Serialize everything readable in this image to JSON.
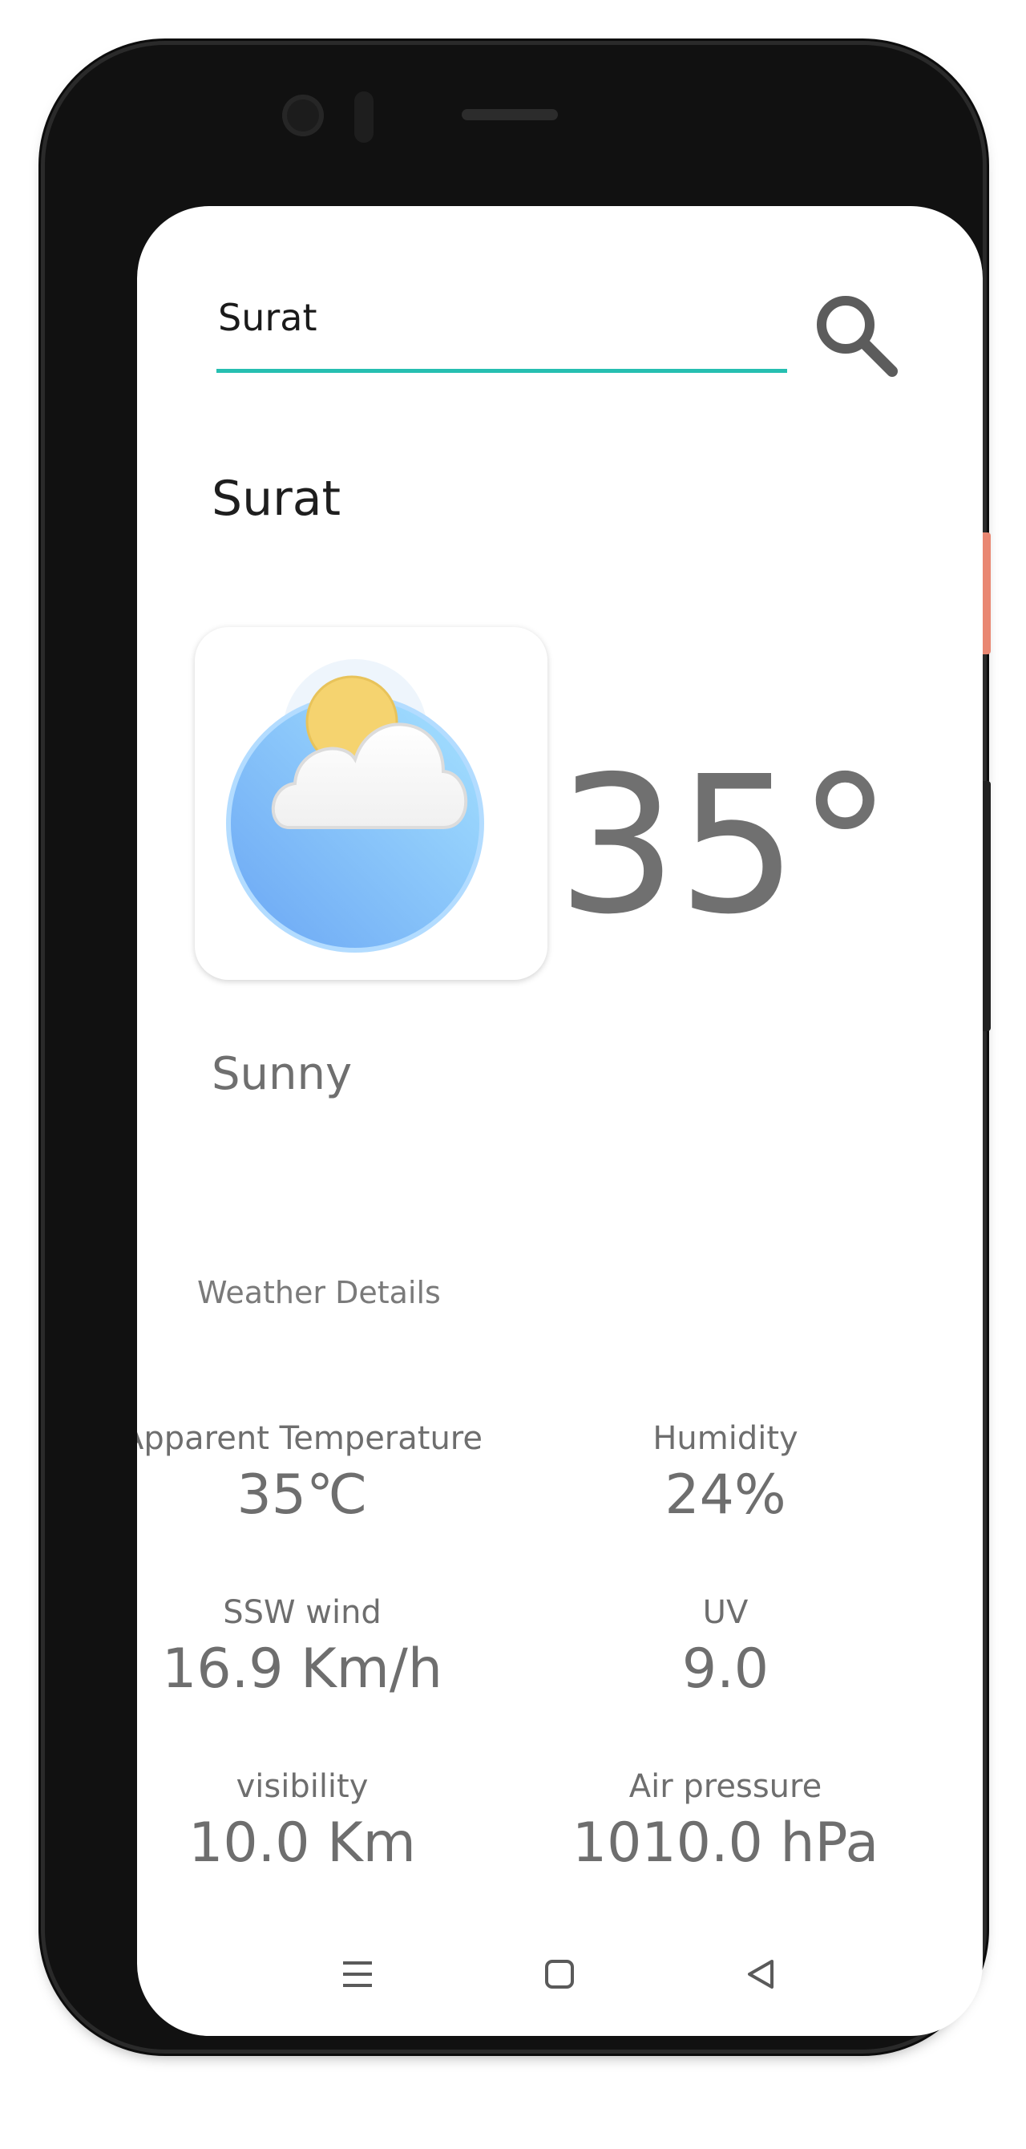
{
  "search": {
    "value": "Surat",
    "icon": "search-icon"
  },
  "weather": {
    "city": "Surat",
    "temperature": "35°",
    "condition": "Sunny",
    "condition_icon": "partly-cloudy-icon"
  },
  "details": {
    "title": "Weather Details",
    "items": [
      {
        "label": "Apparent Temperature",
        "value": "35℃"
      },
      {
        "label": "Humidity",
        "value": "24%"
      },
      {
        "label": "SSW wind",
        "value": "16.9 Km/h"
      },
      {
        "label": "UV",
        "value": "9.0"
      },
      {
        "label": "visibility",
        "value": "10.0 Km"
      },
      {
        "label": "Air pressure",
        "value": "1010.0 hPa"
      }
    ]
  },
  "nav": {
    "menu_icon": "menu-icon",
    "home_icon": "home-square-icon",
    "back_icon": "back-triangle-icon"
  },
  "colors": {
    "accent": "#26bfb1",
    "text_dark": "#1e1e1e",
    "text_muted": "#6e6e6e",
    "sun": "#f5d36f",
    "sky": "#7fb9f7"
  }
}
